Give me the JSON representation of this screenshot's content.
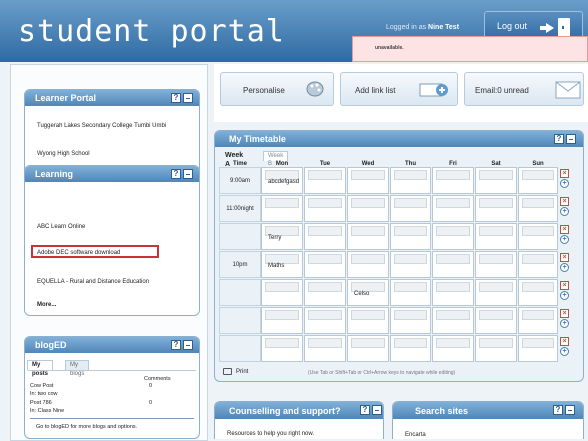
{
  "header": {
    "brand": "student portal",
    "login_status_prefix": "Logged in as",
    "login_user": "Nine Test",
    "logout_label": "Log out"
  },
  "learner_portal": {
    "title": "Learner Portal",
    "links": [
      "Tuggerah Lakes Secondary College Tumbi Umbi",
      "Wyong High School"
    ]
  },
  "learning": {
    "title": "Learning",
    "links": [
      "ABC Learn Online",
      "Adobe DEC software download",
      "EQUELLA - Rural and Distance Education"
    ],
    "more_label": "More...",
    "highlight_color": "#c8323a"
  },
  "blog": {
    "title": "blogED",
    "tabs": [
      "My posts",
      "My blogs"
    ],
    "comments_header": "Comments",
    "posts": [
      {
        "title": "Cow Post",
        "blog": "In: two cow",
        "comments": "0"
      },
      {
        "title": "Post 786",
        "blog": "In: Class Nine",
        "comments": "0"
      }
    ],
    "footer": "Go to blogED for more blogs and options."
  },
  "toolbar": {
    "personalise": "Personalise",
    "add_link_list": "Add link list",
    "email": "Email:0 unread"
  },
  "warning": {
    "text": "unavailable."
  },
  "timetable": {
    "title": "My Timetable",
    "week_a": "Week A",
    "week_b": "Week B",
    "days": [
      "Time",
      "Mon",
      "Tue",
      "Wed",
      "Thu",
      "Fri",
      "Sat",
      "Sun"
    ],
    "rows": [
      {
        "time": "9:00am",
        "cells": [
          "abcdefgasd",
          "",
          "",
          "",
          "",
          "",
          ""
        ]
      },
      {
        "time": "11:00night",
        "cells": [
          "",
          "",
          "",
          "",
          "",
          "",
          ""
        ]
      },
      {
        "time": "",
        "cells": [
          "Terry",
          "",
          "",
          "",
          "",
          "",
          ""
        ]
      },
      {
        "time": "10pm",
        "cells": [
          "Maths",
          "",
          "",
          "",
          "",
          "",
          ""
        ]
      },
      {
        "time": "",
        "cells": [
          "",
          "",
          "Celso",
          "",
          "",
          "",
          ""
        ]
      },
      {
        "time": "",
        "cells": [
          "",
          "",
          "",
          "",
          "",
          "",
          ""
        ]
      },
      {
        "time": "",
        "cells": [
          "",
          "",
          "",
          "",
          "",
          "",
          ""
        ]
      }
    ],
    "print_label": "Print",
    "help_text": "(Use Tab or Shift+Tab or Ctrl+Arrow keys to navigate while editing)"
  },
  "counselling": {
    "title": "Counselling and support?",
    "text": "Resources to help you right now."
  },
  "search_sites": {
    "title": "Search sites",
    "first_link": "Encarta"
  },
  "icons": {
    "help": "help-icon",
    "minimize": "minimize-icon",
    "logout": "logout-door-icon",
    "personalise": "palette-icon",
    "add_link": "add-link-icon",
    "email": "envelope-icon",
    "delete_row": "delete-row-icon",
    "add_row": "add-row-icon",
    "print": "printer-icon"
  }
}
